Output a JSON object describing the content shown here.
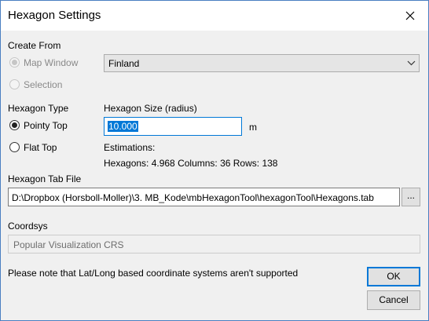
{
  "window": {
    "title": "Hexagon Settings"
  },
  "create_from": {
    "heading": "Create From",
    "map_window_label": "Map Window",
    "selection_label": "Selection",
    "map_select_value": "Finland"
  },
  "hexagon_type": {
    "heading": "Hexagon Type",
    "pointy_top_label": "Pointy Top",
    "flat_top_label": "Flat Top"
  },
  "hexagon_size": {
    "heading": "Hexagon Size (radius)",
    "value": "10.000",
    "unit": "m"
  },
  "estimations": {
    "heading": "Estimations:",
    "summary": "Hexagons: 4.968 Columns: 36 Rows: 138"
  },
  "tab_file": {
    "heading": "Hexagon Tab File",
    "path": "D:\\Dropbox (Horsboll-Moller)\\3. MB_Kode\\mbHexagonTool\\hexagonTool\\Hexagons.tab",
    "browse_label": "..."
  },
  "coordsys": {
    "heading": "Coordsys",
    "value": "Popular Visualization CRS"
  },
  "footer": {
    "note": "Please note that Lat/Long based coordinate systems aren't supported",
    "ok_label": "OK",
    "cancel_label": "Cancel"
  }
}
